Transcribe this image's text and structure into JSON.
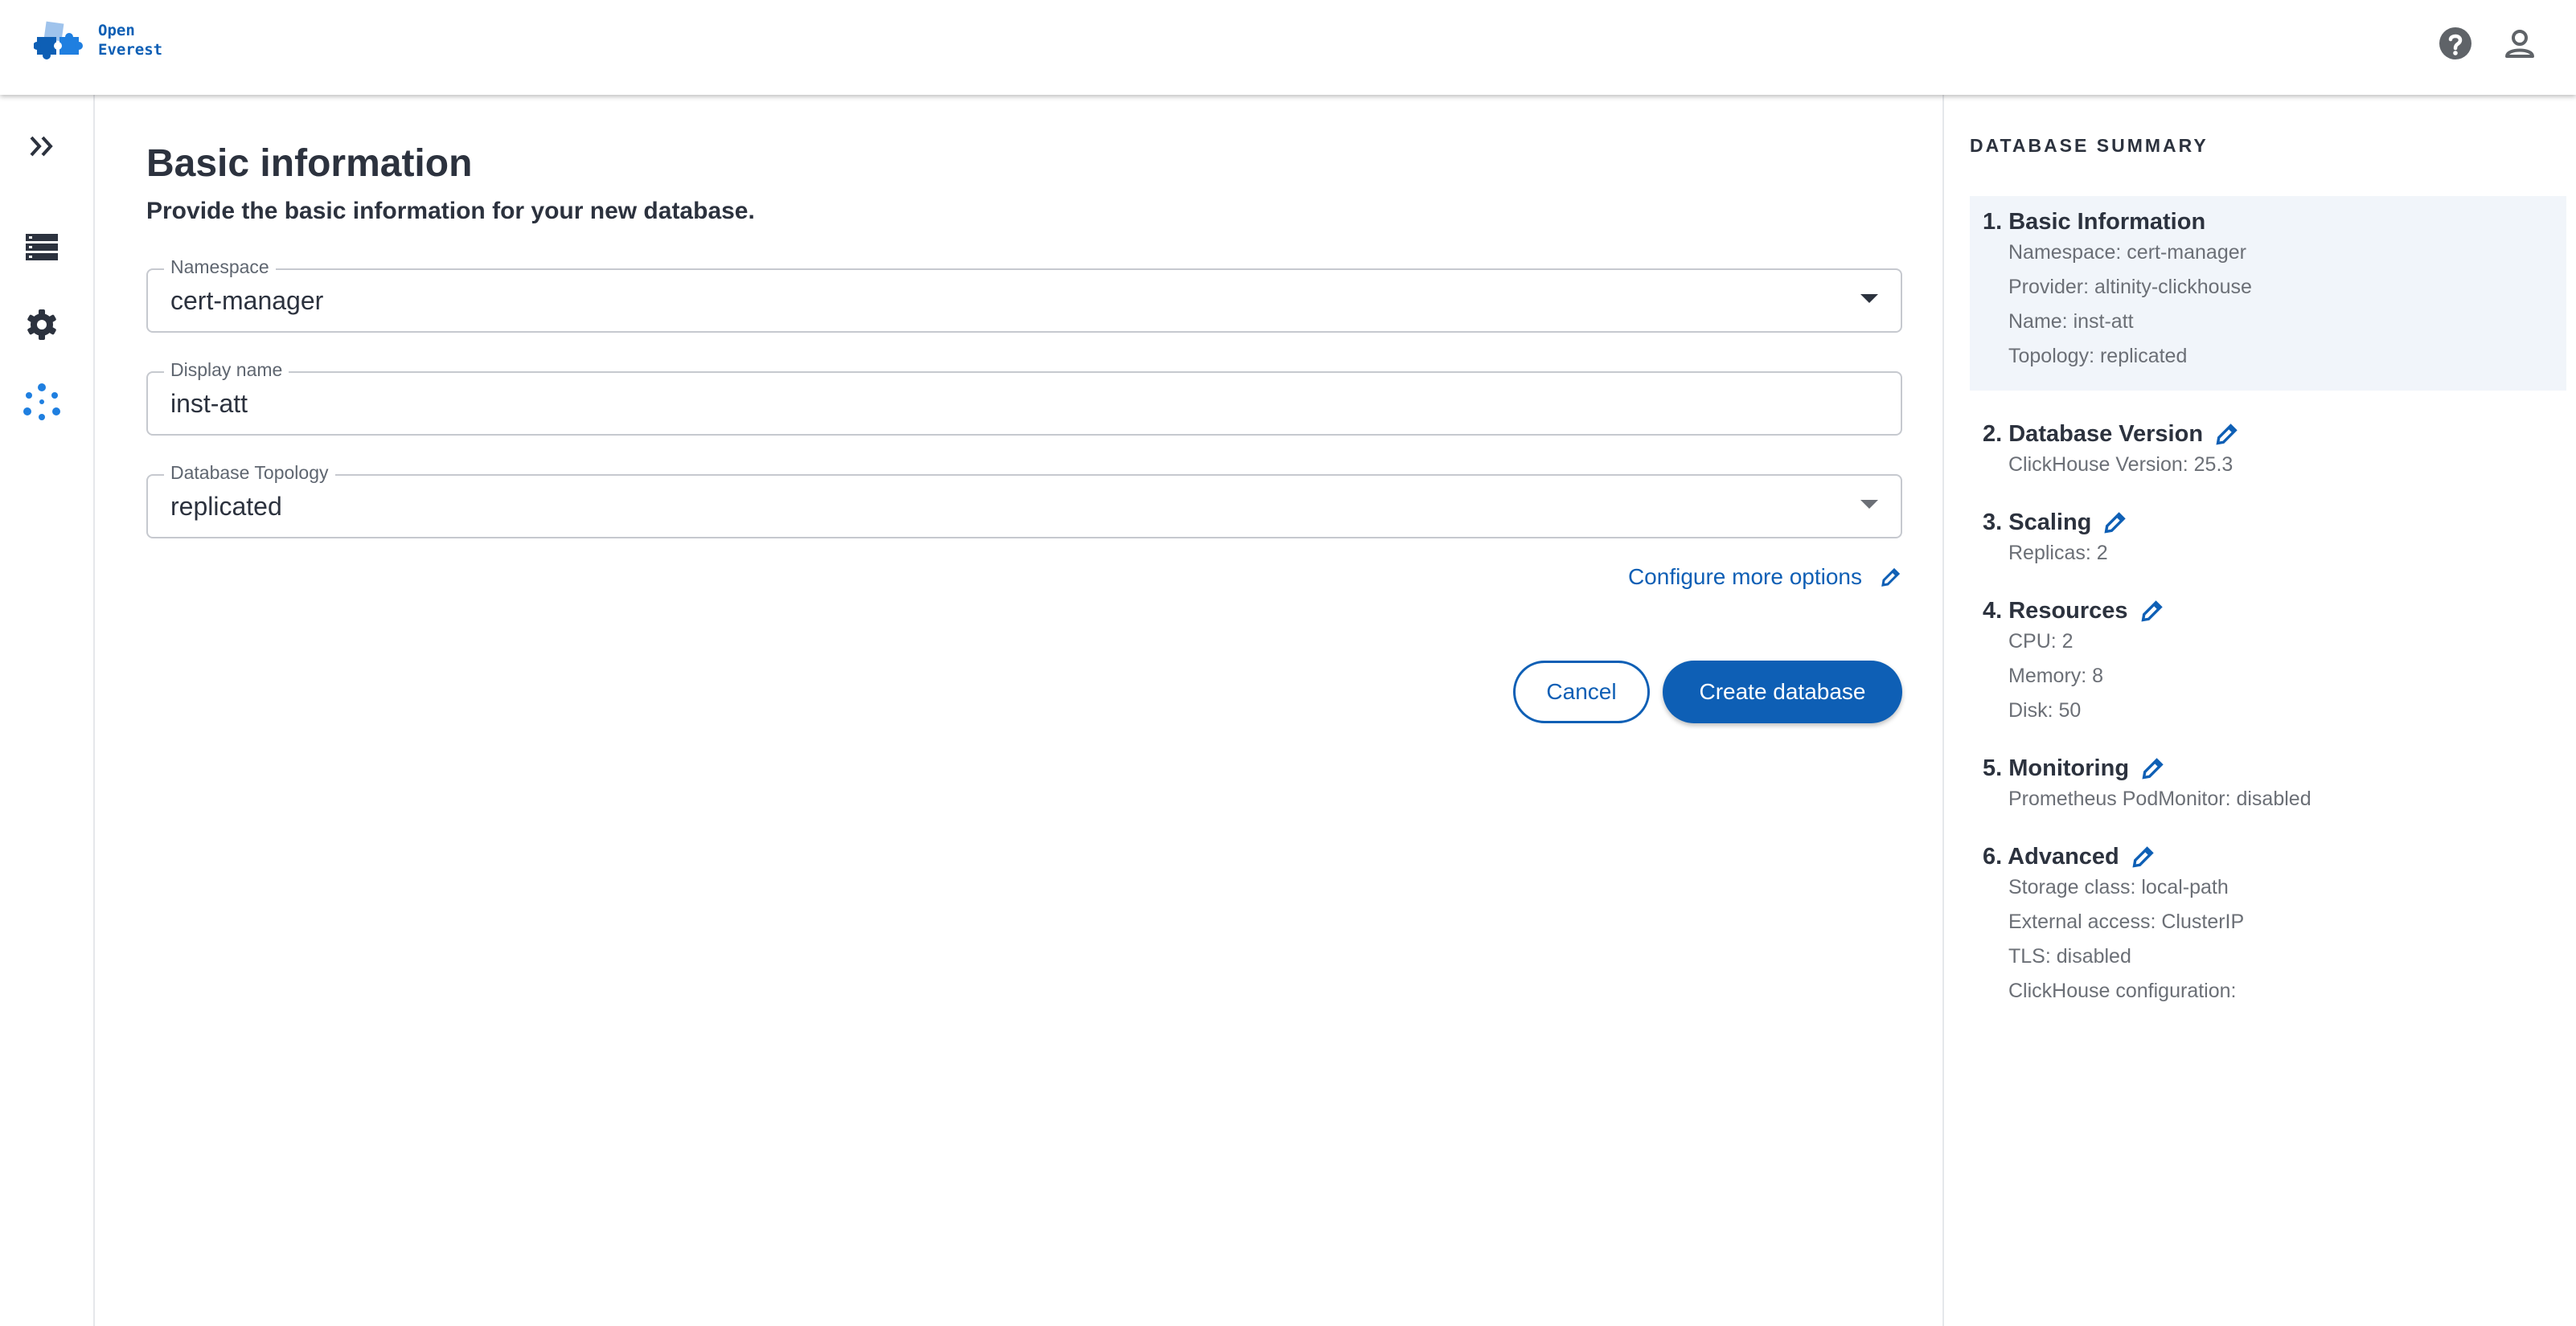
{
  "app": {
    "logo_line1": "Open",
    "logo_line2": "Everest",
    "accent_color": "#0e5fb5"
  },
  "topbar_icons": [
    "help-circle-icon",
    "user-account-icon"
  ],
  "rail": {
    "items": [
      "expand-chevrons-icon",
      "databases-stack-icon",
      "settings-gear-icon",
      "dots-cluster-icon"
    ]
  },
  "form": {
    "title": "Basic information",
    "subtitle": "Provide the basic information for your new database.",
    "namespace": {
      "label": "Namespace",
      "value": "cert-manager"
    },
    "display_name": {
      "label": "Display name",
      "value": "inst-att"
    },
    "topology": {
      "label": "Database Topology",
      "value": "replicated"
    },
    "configure_link": "Configure more options",
    "cancel_label": "Cancel",
    "create_label": "Create database"
  },
  "summary": {
    "title": "DATABASE SUMMARY",
    "sections": [
      {
        "title": "1. Basic Information",
        "items": [
          "Namespace: cert-manager",
          "Provider: altinity-clickhouse",
          "Name: inst-att",
          "Topology: replicated"
        ]
      },
      {
        "title": "2. Database Version",
        "items": [
          "ClickHouse Version: 25.3"
        ]
      },
      {
        "title": "3. Scaling",
        "items": [
          "Replicas: 2"
        ]
      },
      {
        "title": "4. Resources",
        "items": [
          "CPU: 2",
          "Memory: 8",
          "Disk: 50"
        ]
      },
      {
        "title": "5. Monitoring",
        "items": [
          "Prometheus PodMonitor: disabled"
        ]
      },
      {
        "title": "6. Advanced",
        "items": [
          "Storage class: local-path",
          "External access: ClusterIP",
          "TLS: disabled",
          "ClickHouse configuration:"
        ]
      }
    ]
  }
}
